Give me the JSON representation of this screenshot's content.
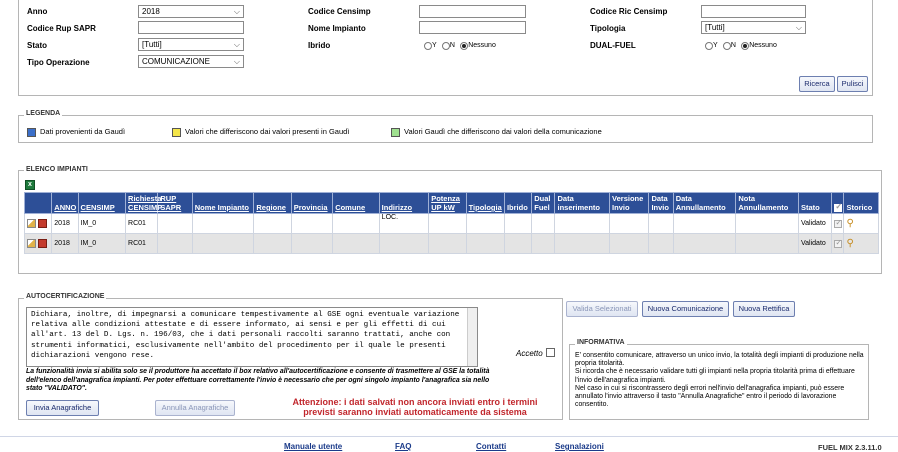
{
  "filters": {
    "anno_label": "Anno",
    "anno_value": "2018",
    "codice_censimp_label": "Codice Censimp",
    "codice_censimp_value": "",
    "codice_ric_censimp_label": "Codice Ric Censimp",
    "codice_ric_censimp_value": "",
    "codice_rup_label": "Codice Rup SAPR",
    "codice_rup_value": "",
    "nome_impianto_label": "Nome Impianto",
    "nome_impianto_value": "",
    "tipologia_label": "Tipologia",
    "tipologia_value": "[Tutti]",
    "stato_label": "Stato",
    "stato_value": "[Tutti]",
    "ibrido_label": "Ibrido",
    "dual_fuel_label": "DUAL-FUEL",
    "tipo_operazione_label": "Tipo Operazione",
    "tipo_operazione_value": "COMUNICAZIONE",
    "radio_y": "Y",
    "radio_n": "N",
    "radio_nessuno": "Nessuno",
    "ricerca_label": "Ricerca",
    "pulisci_label": "Pulisci"
  },
  "legenda": {
    "title": "LEGENDA",
    "items": [
      {
        "label": "Dati provenienti da Gaudì",
        "color": "#3b6fc9"
      },
      {
        "label": "Valori che differiscono dai valori presenti in Gaudì",
        "color": "#f4e64a"
      },
      {
        "label": "Valori Gaudì che differiscono dai valori della comunicazione",
        "color": "#9fe08f"
      }
    ]
  },
  "elenco": {
    "title": "ELENCO IMPIANTI",
    "headers": [
      "ANNO",
      "CENSIMP",
      "Richiesta CENSIMP",
      "RUP SAPR",
      "Nome Impianto",
      "Regione",
      "Provincia",
      "Comune",
      "Indirizzo",
      "Potenza UP kW",
      "Tipologia",
      "Ibrido",
      "Dual Fuel",
      "Data inserimento",
      "Versione Invio",
      "Data Invio",
      "Data Annullamento",
      "Nota Annullamento",
      "Stato",
      "",
      "Storico"
    ],
    "rows": [
      {
        "anno": "2018",
        "censimp": "IM_0",
        "richiesta": "RC01",
        "indirizzo": "LOC.",
        "stato": "Validato"
      },
      {
        "anno": "2018",
        "censimp": "IM_0",
        "richiesta": "RC01",
        "indirizzo": "",
        "stato": "Validato"
      }
    ]
  },
  "buttons": {
    "valida": "Valida Selezionati",
    "nuova_comunicazione": "Nuova Comunicazione",
    "nuova_rettifica": "Nuova Rettifica",
    "invia": "Invia Anagrafiche",
    "annulla": "Annulla Anagrafiche"
  },
  "autocert": {
    "title": "AUTOCERTIFICAZIONE",
    "text": "Dichiara, inoltre, di impegnarsi a comunicare tempestivamente al GSE ogni eventuale variazione relativa alle condizioni attestate e di essere informato, ai sensi e per gli effetti di cui all'art. 13 del D. Lgs. n. 196/03, che i dati personali raccolti saranno trattati, anche con strumenti informatici, esclusivamente nell'ambito del procedimento per il quale le presenti dichiarazioni vengono rese.",
    "accetto": "Accetto",
    "note": "La funzionalità invia si abilita solo se il produttore ha accettato il box relativo all'autocertificazione e consente di trasmettere al GSE la totalità dell'elenco dell'anagrafica impianti. Per poter effettuare correttamente l'invio è necessario che per ogni singolo impianto l'anagrafica sia nello stato \"VALIDATO\".",
    "warning": "Attenzione: i dati salvati non ancora inviati entro i termini previsti saranno inviati automaticamente da sistema"
  },
  "informativa": {
    "title": "INFORMATIVA",
    "text": "E' consentito comunicare, attraverso un unico invio, la totalità degli impianti di produzione nella propria titolarità.\nSi ricorda che è necessario validare tutti gli impianti nella propria titolarità prima di effettuare l'invio dell'anagrafica impianti.\nNel caso in cui si riscontrassero degli errori nell'invio dell'anagrafica impianti, può essere annullato l'invio attraverso il tasto \"Annulla Anagrafiche\" entro il periodo di lavorazione consentito."
  },
  "footer": {
    "manuale": "Manuale utente",
    "faq": "FAQ",
    "contatti": "Contatti",
    "segnalazioni": "Segnalazioni",
    "version": "FUEL MIX 2.3.11.0"
  }
}
